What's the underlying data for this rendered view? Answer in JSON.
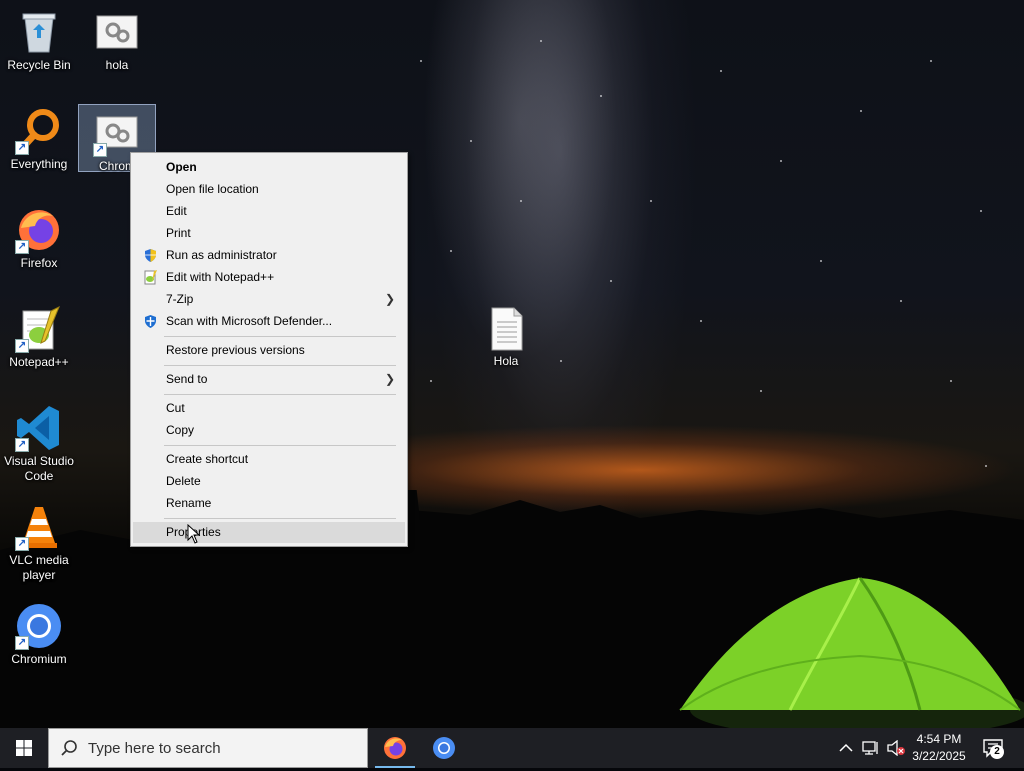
{
  "desktop": {
    "icons": [
      {
        "label": "Recycle Bin",
        "icon": "recycle-bin-icon"
      },
      {
        "label": "hola",
        "icon": "settings-file-icon"
      },
      {
        "label": "Everything",
        "icon": "everything-search-icon"
      },
      {
        "label": "Chromium",
        "icon": "settings-file-icon",
        "visible_label": "Chrom"
      },
      {
        "label": "Firefox",
        "icon": "firefox-icon"
      },
      {
        "label": "Notepad++",
        "icon": "notepad-plus-plus-icon"
      },
      {
        "label": "Hola",
        "icon": "text-document-icon"
      },
      {
        "label": "Visual Studio Code",
        "icon": "vscode-icon"
      },
      {
        "label": "VLC media player",
        "icon": "vlc-cone-icon"
      },
      {
        "label": "Chromium",
        "icon": "chromium-icon"
      }
    ]
  },
  "context_menu": {
    "items": [
      {
        "label": "Open"
      },
      {
        "label": "Open file location"
      },
      {
        "label": "Edit"
      },
      {
        "label": "Print"
      },
      {
        "label": "Run as administrator",
        "icon": "uac-shield-icon"
      },
      {
        "label": "Edit with Notepad++",
        "icon": "notepad-plus-plus-icon"
      },
      {
        "label": "7-Zip"
      },
      {
        "label": "Scan with Microsoft Defender...",
        "icon": "defender-shield-icon"
      },
      {
        "label": "Restore previous versions"
      },
      {
        "label": "Send to"
      },
      {
        "label": "Cut"
      },
      {
        "label": "Copy"
      },
      {
        "label": "Create shortcut"
      },
      {
        "label": "Delete"
      },
      {
        "label": "Rename"
      },
      {
        "label": "Properties"
      }
    ],
    "submenu_arrow": "❯"
  },
  "taskbar": {
    "search_placeholder": "Type here to search",
    "pinned_apps": [
      "firefox-icon",
      "chromium-icon"
    ],
    "clock_time": "4:54 PM",
    "clock_date": "3/22/2025",
    "notification_count": "2"
  },
  "colors": {
    "menu_bg": "#f0f0f0",
    "menu_hover": "#dadada",
    "taskbar_bg": "#1e1f24",
    "accent": "#76b9ed",
    "tent_green": "#7cd128"
  }
}
